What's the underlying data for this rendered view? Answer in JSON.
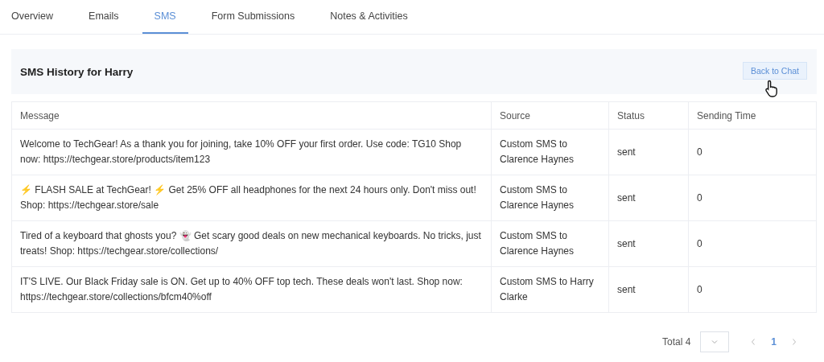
{
  "tabs": [
    {
      "label": "Overview",
      "selected": false
    },
    {
      "label": "Emails",
      "selected": false
    },
    {
      "label": "SMS",
      "selected": true
    },
    {
      "label": "Form Submissions",
      "selected": false
    },
    {
      "label": "Notes & Activities",
      "selected": false
    }
  ],
  "panel": {
    "title": "SMS History for Harry",
    "back_button": "Back to Chat"
  },
  "table": {
    "columns": [
      "Message",
      "Source",
      "Status",
      "Sending Time"
    ],
    "rows": [
      {
        "message": "Welcome to TechGear! As a thank you for joining, take 10% OFF your first order. Use code: TG10 Shop now: https://techgear.store/products/item123",
        "source": "Custom SMS to Clarence Haynes",
        "status": "sent",
        "sending_time": "0"
      },
      {
        "message": "⚡ FLASH SALE at TechGear! ⚡ Get 25% OFF all headphones for the next 24 hours only. Don't miss out! Shop: https://techgear.store/sale",
        "source": "Custom SMS to Clarence Haynes",
        "status": "sent",
        "sending_time": "0"
      },
      {
        "message": "Tired of a keyboard that ghosts you? 👻 Get scary good deals on new mechanical keyboards. No tricks, just treats! Shop: https://techgear.store/collections/",
        "source": "Custom SMS to Clarence Haynes",
        "status": "sent",
        "sending_time": "0"
      },
      {
        "message": "IT'S LIVE. Our Black Friday sale is ON. Get up to 40% OFF top tech. These deals won't last. Shop now: https://techgear.store/collections/bfcm40%off",
        "source": "Custom SMS to Harry Clarke",
        "status": "sent",
        "sending_time": "0"
      }
    ]
  },
  "pagination": {
    "total": "Total 4",
    "pages": [
      {
        "label": "1",
        "selected": true
      }
    ]
  }
}
